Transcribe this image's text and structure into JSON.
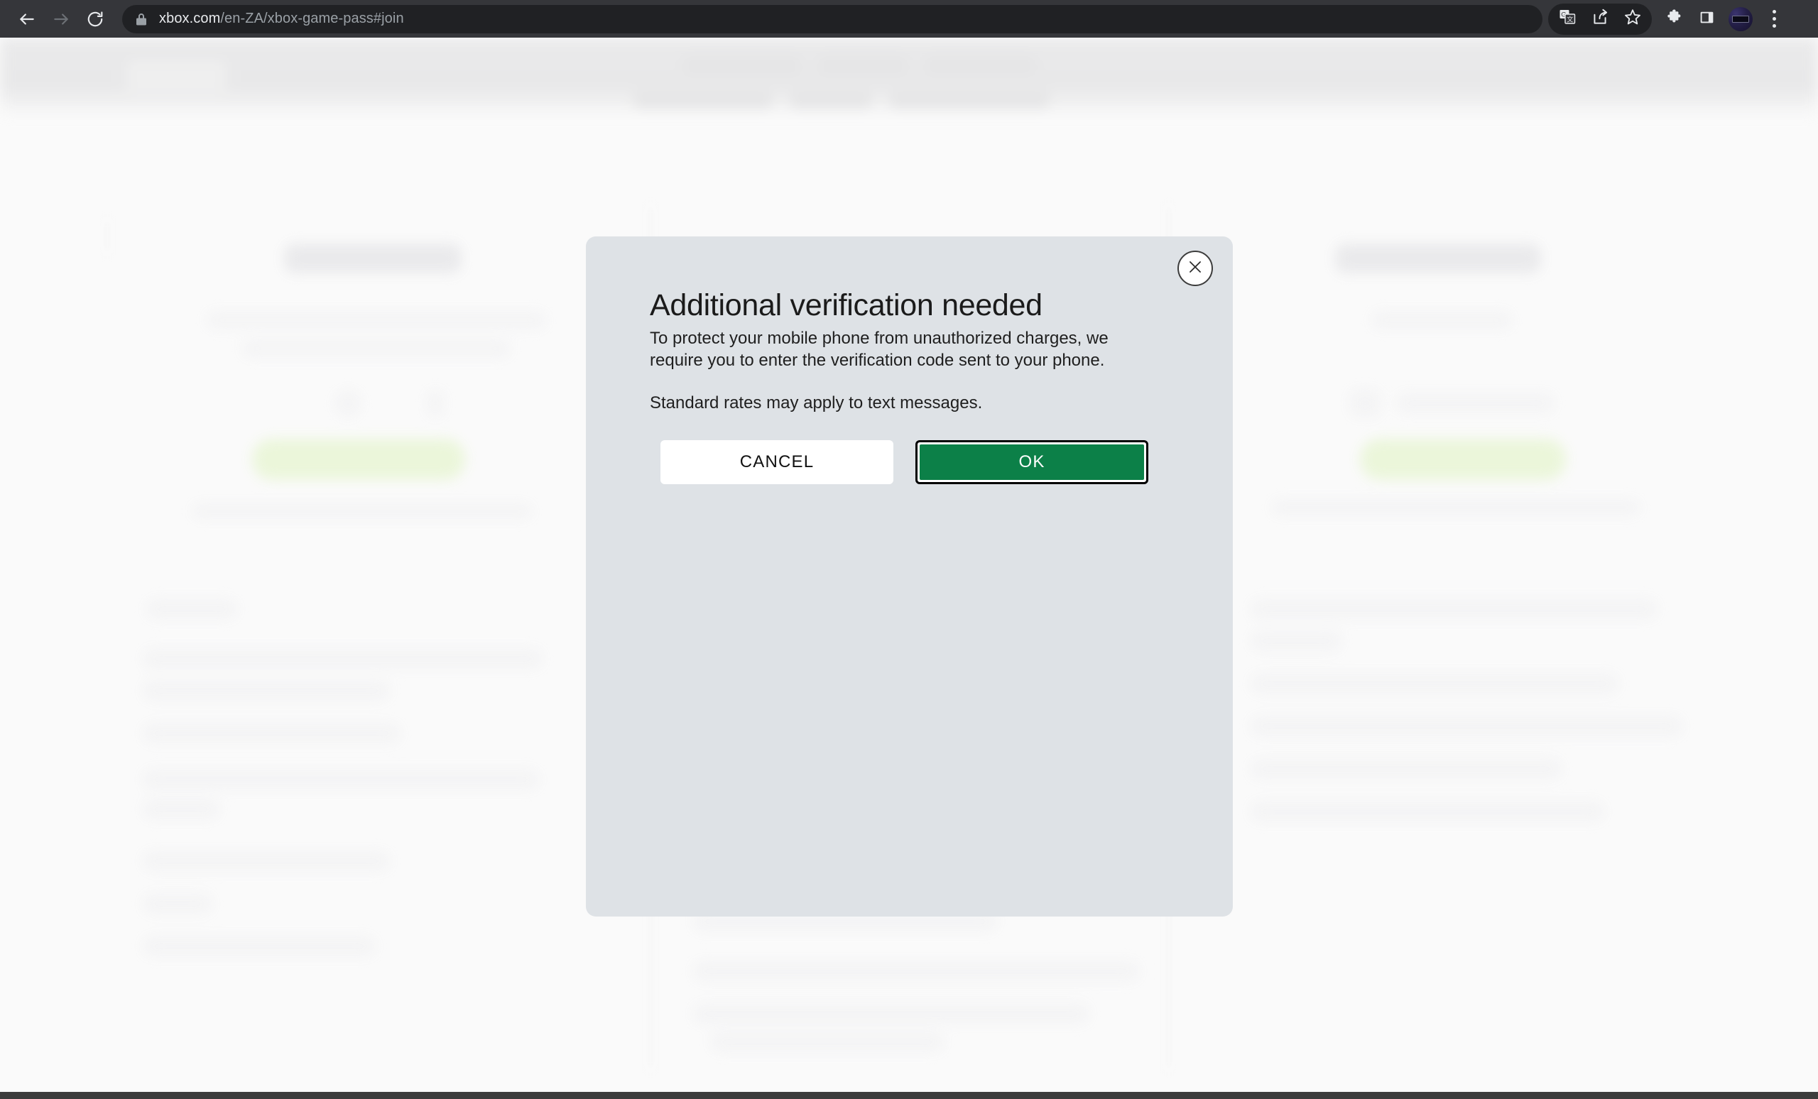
{
  "browser": {
    "back_label": "Back",
    "forward_label": "Forward",
    "reload_label": "Reload",
    "url_domain": "xbox.com",
    "url_path": "/en-ZA/xbox-game-pass#join",
    "lock_icon": "lock-icon",
    "back_icon": "arrow-left-icon",
    "forward_icon": "arrow-right-icon",
    "reload_icon": "reload-icon",
    "toolbar_icons": [
      {
        "name": "translate-icon",
        "label": "Translate this page"
      },
      {
        "name": "share-icon",
        "label": "Share this page"
      },
      {
        "name": "bookmark-star-icon",
        "label": "Bookmark this tab"
      },
      {
        "name": "extensions-puzzle-icon",
        "label": "Extensions"
      },
      {
        "name": "side-panel-icon",
        "label": "Side panel"
      }
    ],
    "avatar_label": "Profile",
    "menu_icon": "kebab-menu-icon",
    "menu_label": "Customize and control Google Chrome"
  },
  "modal": {
    "title": "Additional verification needed",
    "paragraph_1": "To protect your mobile phone from unauthorized charges, we require you to enter the verification code sent to your phone.",
    "paragraph_2": "Standard rates may apply to text messages.",
    "cancel_label": "CANCEL",
    "ok_label": "OK",
    "close_icon": "close-x-icon",
    "close_label": "Close",
    "background_color": "#DEE2E6",
    "ok_color": "#0C8048",
    "focus_ring_color": "#000000"
  },
  "page": {
    "background_color": "#FAFAFA",
    "header_color": "#E8E8E9",
    "accent_button_color": "#EAF6D8",
    "note": "Background page content is blurred and unreadable"
  }
}
